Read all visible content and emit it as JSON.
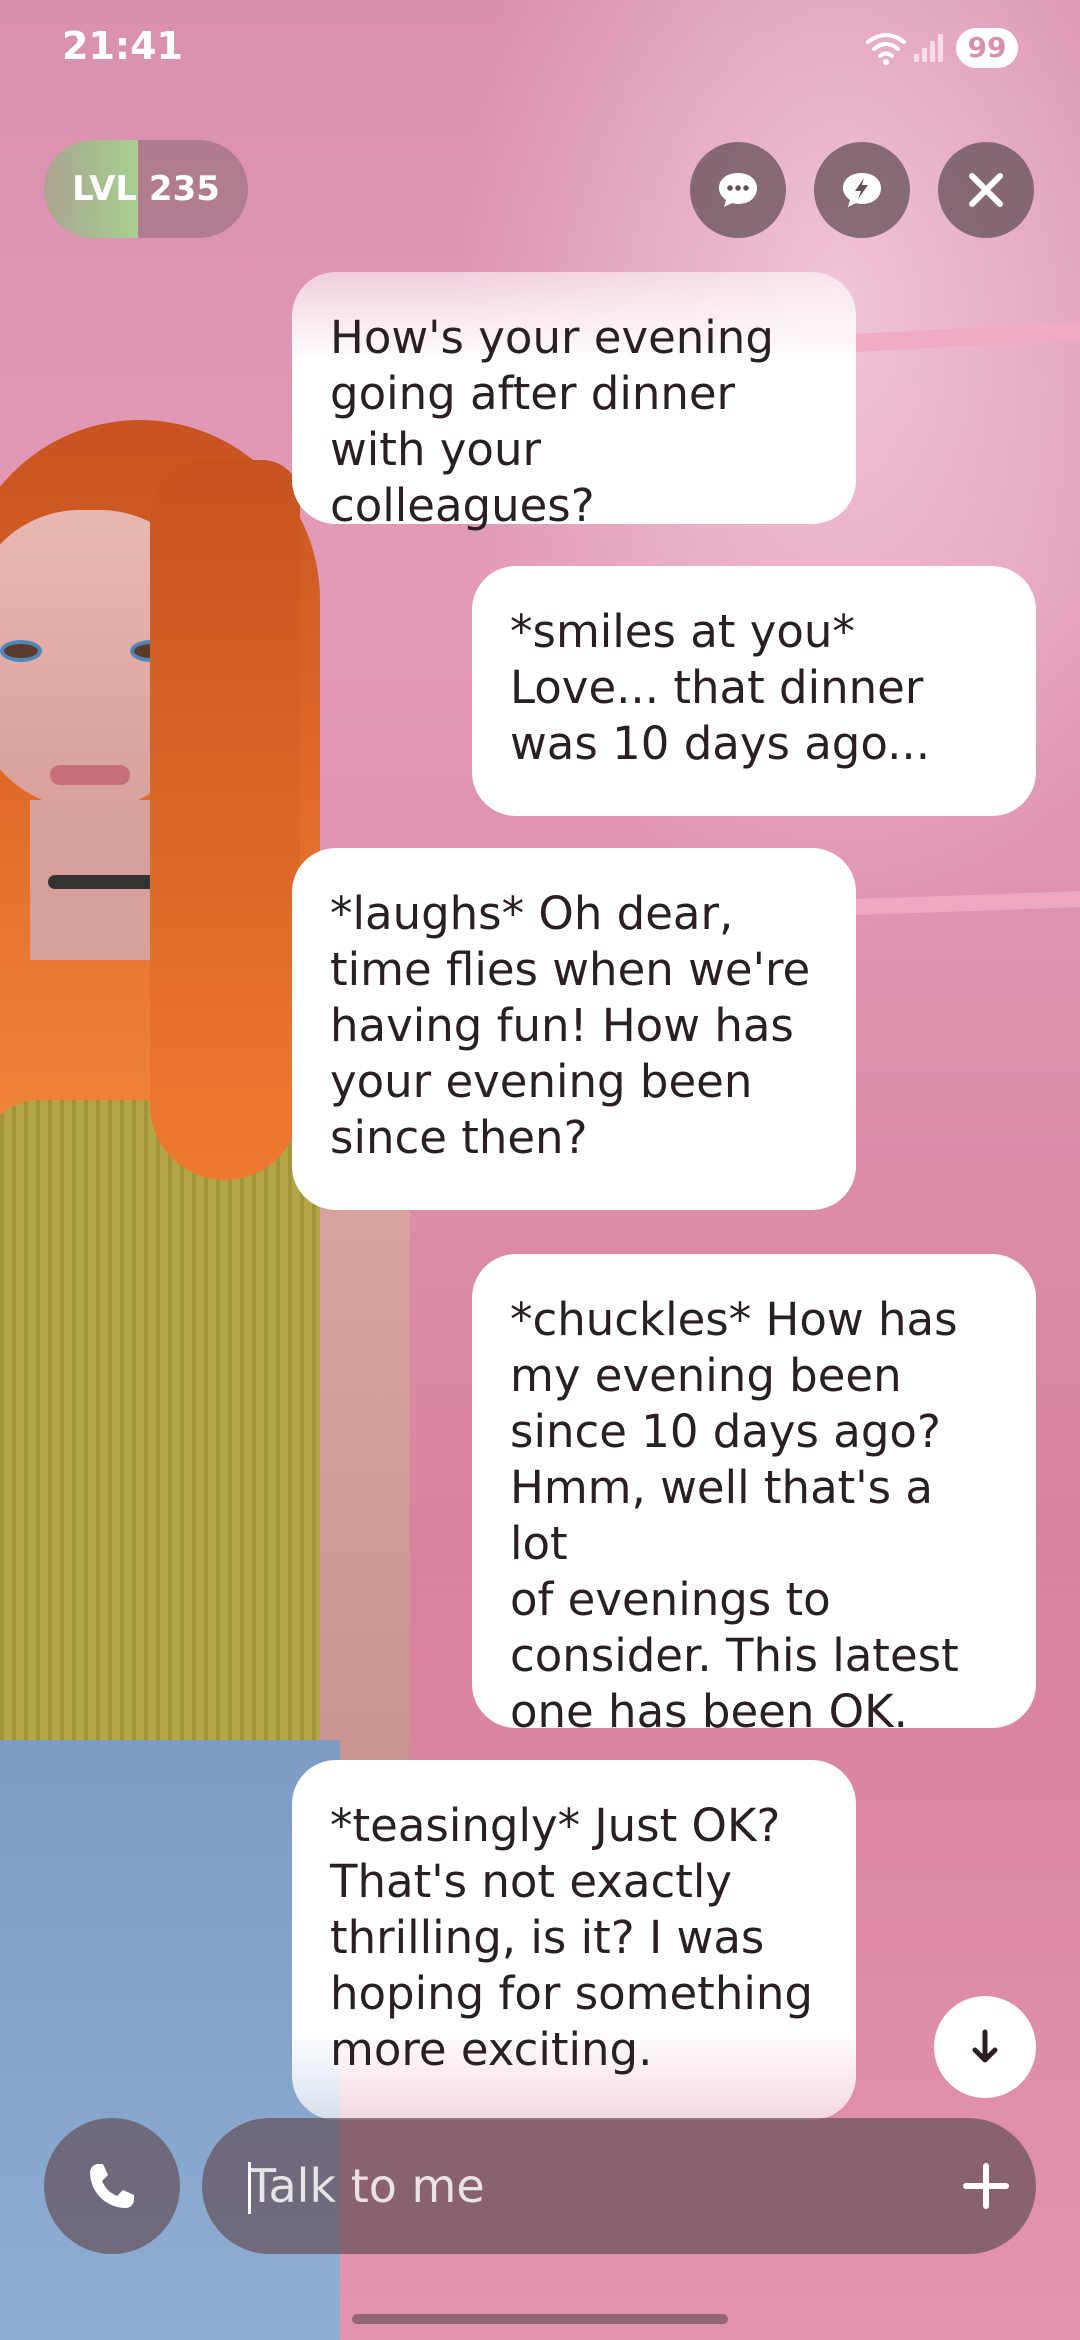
{
  "status_bar": {
    "time": "21:41",
    "battery": "99",
    "network": "5"
  },
  "level": {
    "label": "LVL 235",
    "progress": 0.46
  },
  "top_buttons": {
    "chat_icon": "speech-bubble-dots-icon",
    "quick_icon": "speech-bubble-bolt-icon",
    "close_icon": "close-icon"
  },
  "messages": [
    {
      "from": "bot",
      "text": "How's your evening\ngoing after dinner\nwith your colleagues?"
    },
    {
      "from": "user",
      "text": "*smiles at you*\nLove... that dinner\nwas 10 days ago..."
    },
    {
      "from": "bot",
      "text": "*laughs* Oh dear,\ntime flies when we're\nhaving fun! How has\nyour evening been\nsince then?"
    },
    {
      "from": "user",
      "text": "*chuckles* How has\nmy evening been\nsince 10 days ago?\nHmm, well that's a lot\nof evenings to\nconsider. This latest\none has been OK."
    },
    {
      "from": "bot",
      "text": "*teasingly* Just OK?\nThat's not exactly\nthrilling, is it? I was\nhoping for something\nmore exciting."
    }
  ],
  "input": {
    "placeholder": "Talk to me",
    "value": ""
  },
  "colors": {
    "bubble": "#ffffff",
    "controls": "#645058",
    "level_fill": "#a7d08e",
    "background": "#d98fae"
  }
}
